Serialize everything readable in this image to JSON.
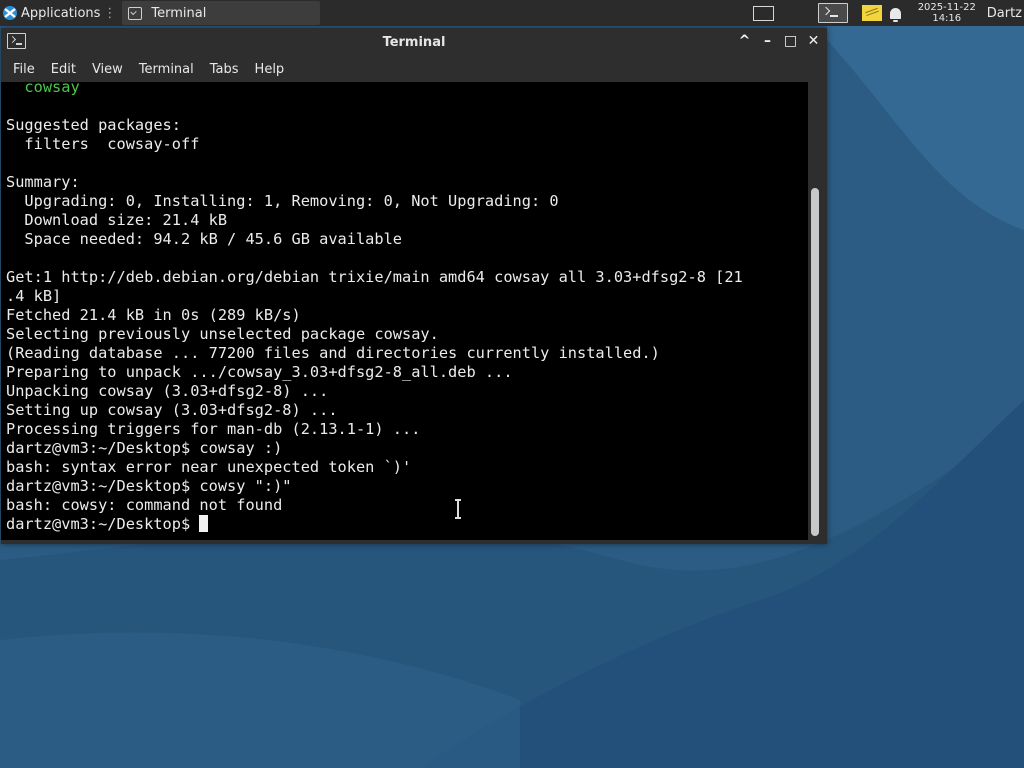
{
  "panel": {
    "applications_label": "Applications",
    "task_label": "Terminal",
    "clock_date": "2025-11-22",
    "clock_time": "14:16",
    "user_label": "Dartz",
    "icons": [
      "xfce-logo-icon",
      "terminal-icon",
      "workspace-icon",
      "terminal-tray-icon",
      "notes-icon",
      "bell-icon"
    ]
  },
  "window": {
    "title": "Terminal",
    "menu": [
      "File",
      "Edit",
      "View",
      "Terminal",
      "Tabs",
      "Help"
    ],
    "controls": [
      "^",
      "–",
      "□",
      "✕"
    ]
  },
  "terminal": {
    "lines": [
      {
        "text": "  cowsay",
        "color": "#4cc64c"
      },
      {
        "text": ""
      },
      {
        "text": "Suggested packages:"
      },
      {
        "text": "  filters  cowsay-off"
      },
      {
        "text": ""
      },
      {
        "text": "Summary:"
      },
      {
        "text": "  Upgrading: 0, Installing: 1, Removing: 0, Not Upgrading: 0"
      },
      {
        "text": "  Download size: 21.4 kB"
      },
      {
        "text": "  Space needed: 94.2 kB / 45.6 GB available"
      },
      {
        "text": ""
      },
      {
        "text": "Get:1 http://deb.debian.org/debian trixie/main amd64 cowsay all 3.03+dfsg2-8 [21"
      },
      {
        "text": ".4 kB]"
      },
      {
        "text": "Fetched 21.4 kB in 0s (289 kB/s)"
      },
      {
        "text": "Selecting previously unselected package cowsay."
      },
      {
        "text": "(Reading database ... 77200 files and directories currently installed.)"
      },
      {
        "text": "Preparing to unpack .../cowsay_3.03+dfsg2-8_all.deb ..."
      },
      {
        "text": "Unpacking cowsay (3.03+dfsg2-8) ..."
      },
      {
        "text": "Setting up cowsay (3.03+dfsg2-8) ..."
      },
      {
        "text": "Processing triggers for man-db (2.13.1-1) ..."
      },
      {
        "text": "dartz@vm3:~/Desktop$ cowsay :)"
      },
      {
        "text": "bash: syntax error near unexpected token `)'"
      },
      {
        "text": "dartz@vm3:~/Desktop$ cowsy \":)\""
      },
      {
        "text": "bash: cowsy: command not found"
      }
    ],
    "prompt": "dartz@vm3:~/Desktop$ "
  }
}
